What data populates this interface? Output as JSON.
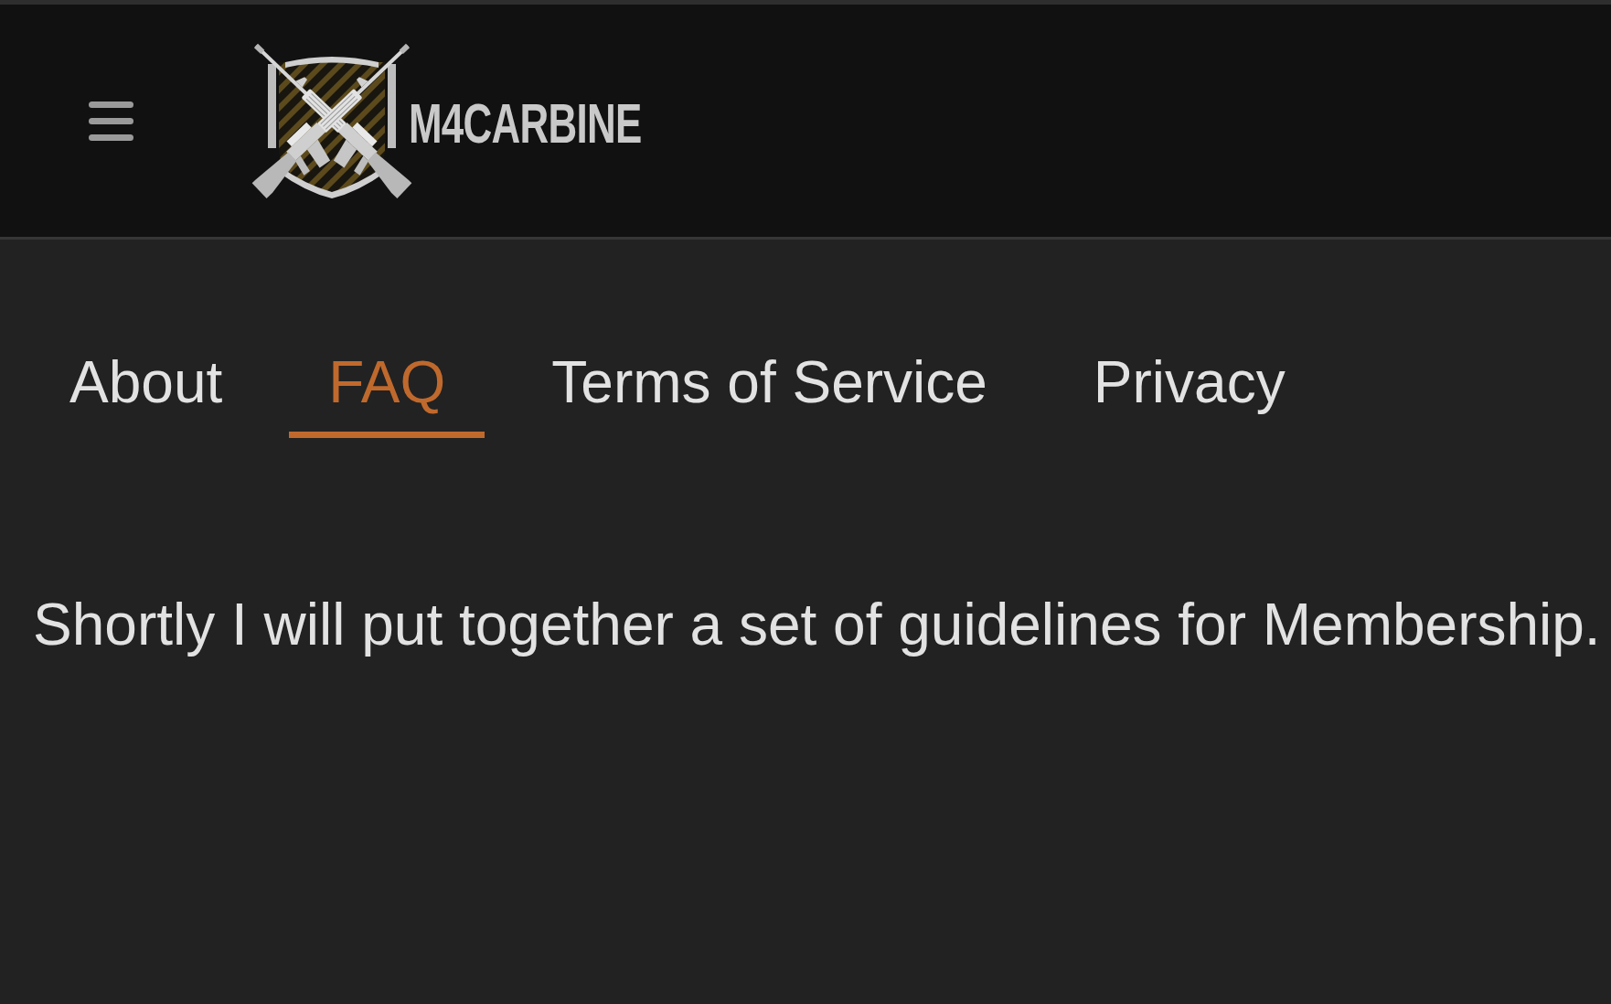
{
  "header": {
    "logo": {
      "text": "M4CARBINE"
    }
  },
  "tabs": [
    {
      "label": "About",
      "selected": false
    },
    {
      "label": "FAQ",
      "selected": true
    },
    {
      "label": "Terms of Service",
      "selected": false
    },
    {
      "label": "Privacy",
      "selected": false
    }
  ],
  "content": {
    "text": "Shortly I will put together a set of guidelines for Membership."
  }
}
